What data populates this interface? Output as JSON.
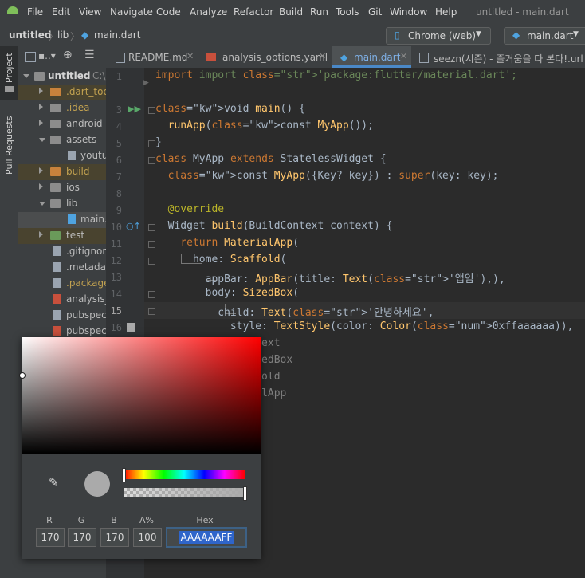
{
  "menu": [
    "File",
    "Edit",
    "View",
    "Navigate",
    "Code",
    "Analyze",
    "Refactor",
    "Build",
    "Run",
    "Tools",
    "Git",
    "Window",
    "Help"
  ],
  "app_title": "untitled - main.dart",
  "breadcrumb": {
    "project": "untitled",
    "folder": "lib",
    "file": "main.dart"
  },
  "device_combo": "Chrome (web)",
  "run_config": "main.dart",
  "left_strip": {
    "project": "Project",
    "pull_requests": "Pull Requests"
  },
  "project_panel": {
    "root_label": "untitled",
    "root_suffix": "C:\\",
    "items": [
      {
        "label": ".dart_tool",
        "type": "folder-orange"
      },
      {
        "label": ".idea",
        "type": "folder"
      },
      {
        "label": "android",
        "type": "folder"
      },
      {
        "label": "assets",
        "type": "folder"
      },
      {
        "label": "youtu",
        "type": "file"
      },
      {
        "label": "build",
        "type": "folder-orange"
      },
      {
        "label": "ios",
        "type": "folder"
      },
      {
        "label": "lib",
        "type": "folder"
      },
      {
        "label": "main.",
        "type": "file"
      },
      {
        "label": "test",
        "type": "folder"
      },
      {
        "label": ".gitignore",
        "type": "file"
      },
      {
        "label": ".metadata",
        "type": "file"
      },
      {
        "label": ".packages",
        "type": "file"
      },
      {
        "label": "analysis_o",
        "type": "file"
      },
      {
        "label": "pubspec.",
        "type": "file"
      },
      {
        "label": "pubspec.",
        "type": "file"
      }
    ]
  },
  "tabs": [
    "README.md",
    "analysis_options.yaml",
    "main.dart",
    "seezn(시즌) - 즐거움을 다 본다!.url"
  ],
  "line_numbers": [
    "1",
    "",
    "3",
    "4",
    "5",
    "6",
    "7",
    "8",
    "9",
    "10",
    "11",
    "12",
    "13",
    "14",
    "15",
    "16"
  ],
  "code_lines": [
    "import 'package:flutter/material.dart';",
    "",
    "void main() {",
    "  runApp(const MyApp());",
    "}",
    "class MyApp extends StatelessWidget {",
    "  const MyApp({Key? key}) : super(key: key);",
    "",
    "  @override",
    "  Widget build(BuildContext context) {",
    "    return MaterialApp(",
    "      home: Scaffold(",
    "        appBar: AppBar(title: Text('앱임'),),",
    "        body: SizedBox(",
    "          child: Text('안녕하세요',",
    "            style: TextStyle(color: Color(0xffaaaaaa)),",
    "          ), // Text",
    "        ), // SizedBox",
    "      ), // Scaffold",
    "    ); // MaterialApp"
  ],
  "color_picker": {
    "labels": {
      "r": "R",
      "g": "G",
      "b": "B",
      "a": "A%",
      "hex": "Hex"
    },
    "r": "170",
    "g": "170",
    "b": "170",
    "a": "100",
    "hex": "AAAAAAFF",
    "preview_color": "#aaaaaa"
  }
}
